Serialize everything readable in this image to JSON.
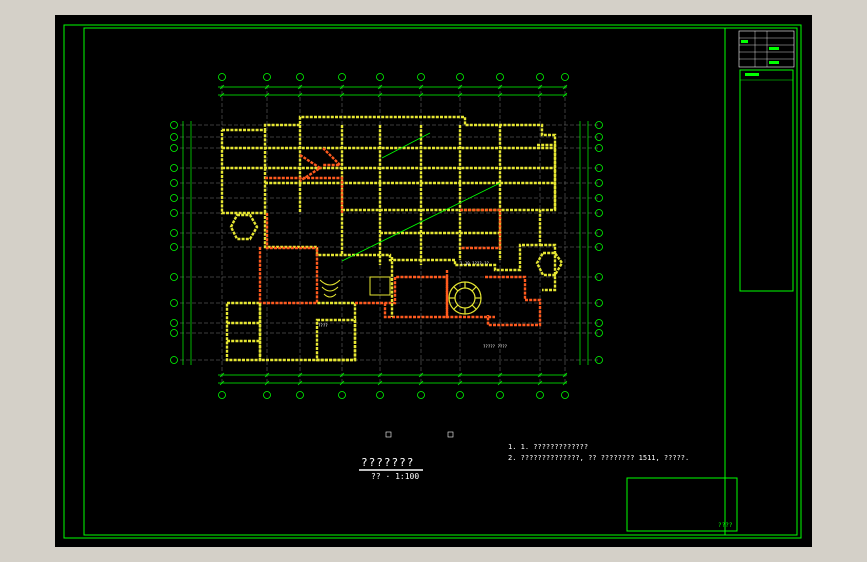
{
  "drawing": {
    "plan_title": "???????",
    "plan_scale": "?? · 1:100",
    "notes": [
      "1. 1. ?????????????",
      "2. ??????????????, ?? ???????? 1511, ?????."
    ],
    "stamp_text": "????"
  },
  "colors": {
    "frame": "#00ff00",
    "background": "#000000",
    "walls": "#e6e632",
    "walls_alt": "#ff5a1e",
    "grid": "#787878",
    "text": "#ffffff"
  }
}
